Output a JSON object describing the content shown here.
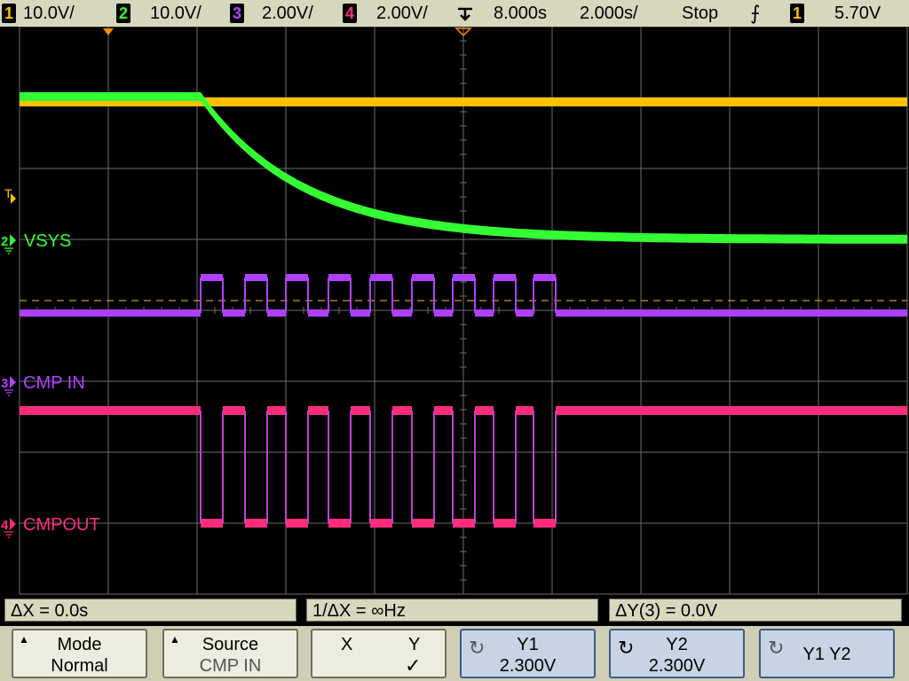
{
  "top_bar": {
    "ch1": {
      "num": "1",
      "scale": "10.0V/",
      "color": "#ffc000"
    },
    "ch2": {
      "num": "2",
      "scale": "10.0V/",
      "color": "#33ff33"
    },
    "ch3": {
      "num": "3",
      "scale": "2.00V/",
      "color": "#b040ff"
    },
    "ch4": {
      "num": "4",
      "scale": "2.00V/",
      "color": "#ff2c7c"
    },
    "time_delay": "8.000s",
    "time_scale": "2.000s/",
    "run_state": "Stop",
    "trigger_slope_symbol": "⨍",
    "trigger_source": "1",
    "trigger_level": "5.70V"
  },
  "scope": {
    "trigger_marker": "T",
    "ch2_label": "VSYS",
    "ch3_label": "CMP IN",
    "ch4_label": "CMPOUT"
  },
  "readouts": {
    "delta_x": "ΔX = 0.0s",
    "inv_delta_x": "1/ΔX = ∞Hz",
    "delta_y": "ΔY(3) = 0.0V"
  },
  "softkeys": {
    "mode": {
      "title": "Mode",
      "value": "Normal"
    },
    "source": {
      "title": "Source",
      "value": "CMP IN"
    },
    "xy": {
      "x": "X",
      "y": "Y",
      "check": "✓"
    },
    "y1": {
      "title": "Y1",
      "value": "2.300V"
    },
    "y2": {
      "title": "Y2",
      "value": "2.300V"
    },
    "y1y2": {
      "title": "Y1 Y2"
    }
  },
  "colors": {
    "ch1": "#ffc000",
    "ch2": "#33ff33",
    "ch3": "#b040ff",
    "ch4": "#ff2c7c",
    "grid": "#6e6e6e",
    "bar": "#d7d7be"
  }
}
